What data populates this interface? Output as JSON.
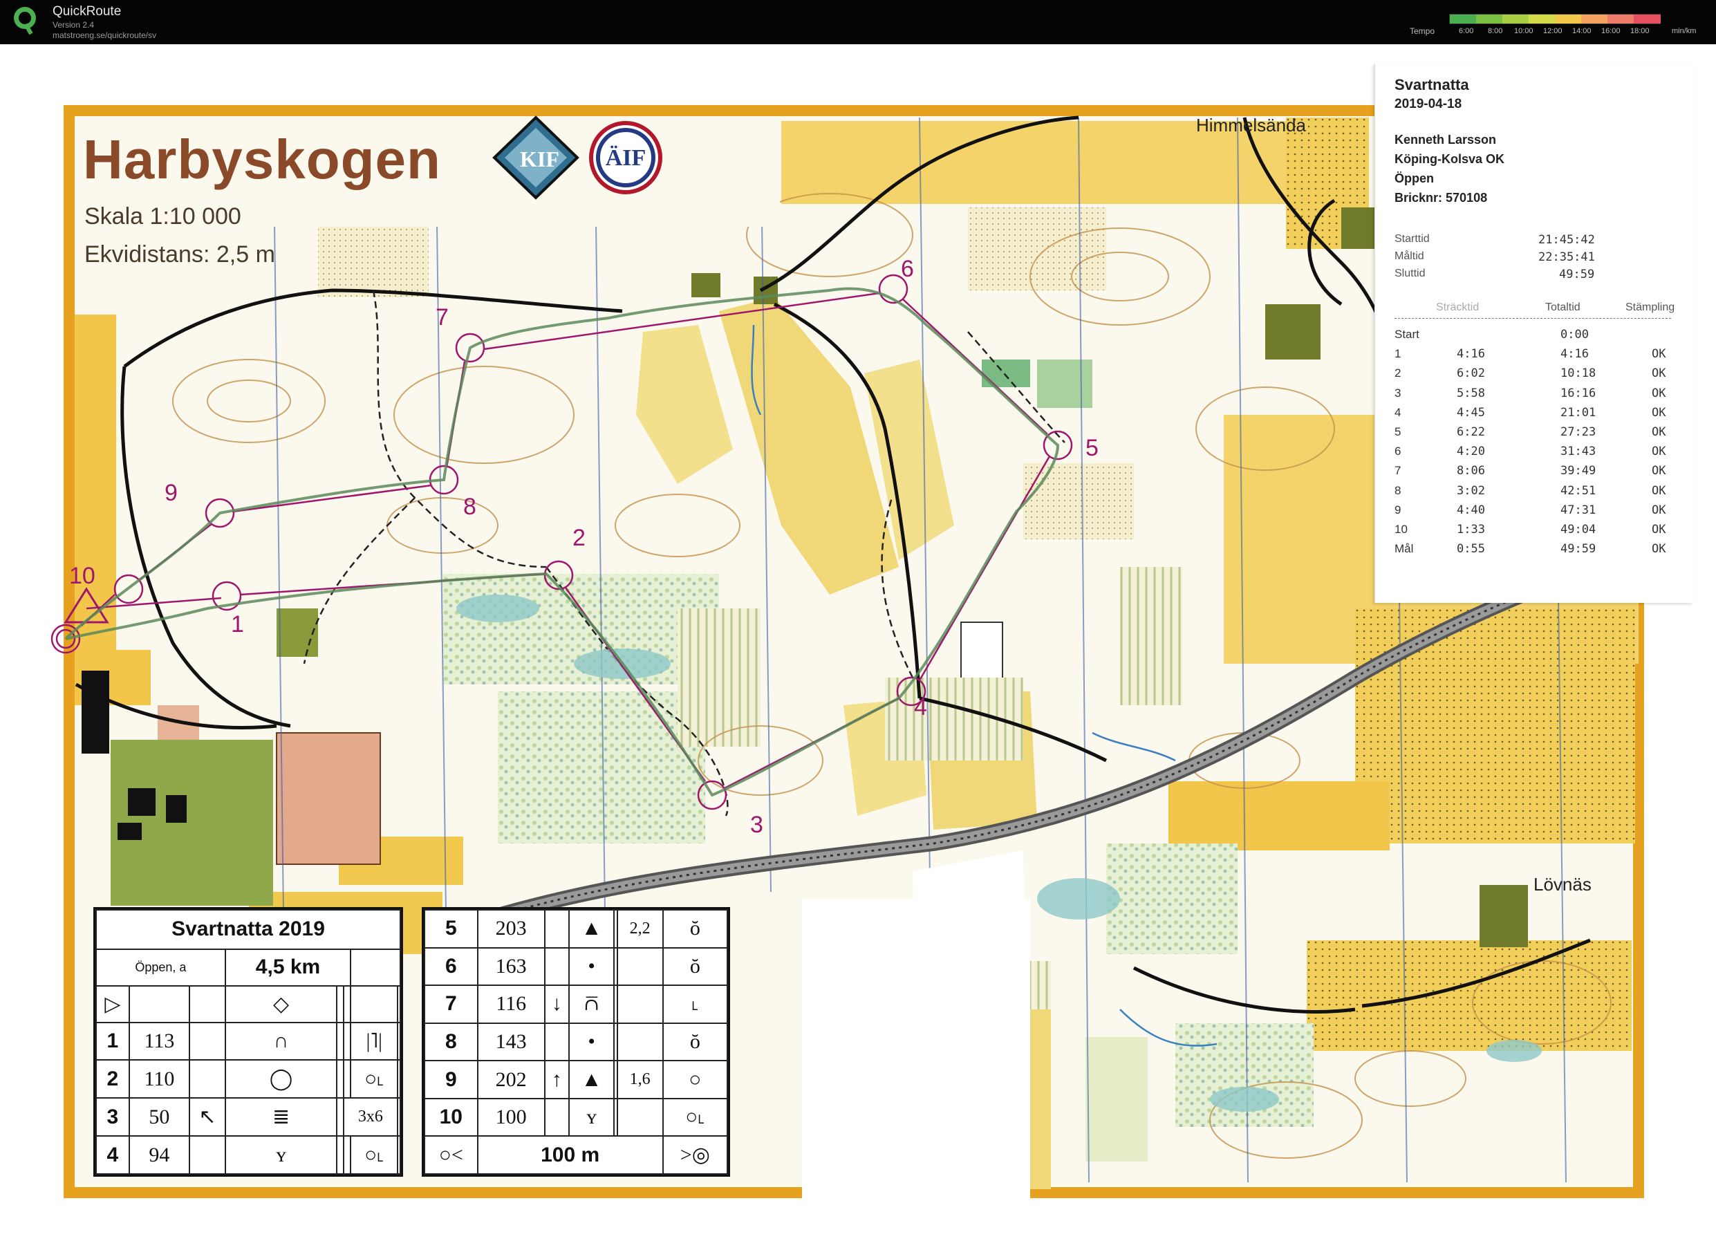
{
  "app": {
    "name": "QuickRoute",
    "version": "Version 2.4",
    "url": "matstroeng.se/quickroute/sv"
  },
  "tempo": {
    "label": "Tempo",
    "ticks": [
      "6:00",
      "8:00",
      "10:00",
      "12:00",
      "14:00",
      "16:00",
      "18:00"
    ],
    "unit": "min/km",
    "colors": [
      "#4caf50",
      "#7bc043",
      "#a8cf45",
      "#d4dc4a",
      "#f2c94c",
      "#f4a460",
      "#ef7b6b",
      "#e6505f"
    ]
  },
  "map": {
    "title": "Harbyskogen",
    "scale": "Skala 1:10 000",
    "ekvidistans": "Ekvidistans: 2,5 m",
    "logo1": "KIF",
    "logo2": "ÄIF",
    "places": {
      "himmelsanda": "Himmelsända",
      "lovnas": "Lövnäs"
    },
    "controls": [
      "1",
      "2",
      "3",
      "4",
      "5",
      "6",
      "7",
      "8",
      "9",
      "10"
    ]
  },
  "description": {
    "event": "Svartnatta 2019",
    "class": "Öppen, a",
    "length": "4,5 km",
    "left_rows": [
      {
        "n": "1",
        "code": "113",
        "d": "∩",
        "e": "",
        "f": "",
        "g": "|˥|"
      },
      {
        "n": "2",
        "code": "110",
        "d": "◯",
        "e": "",
        "f": "",
        "g": "○˪"
      },
      {
        "n": "3",
        "code": "50",
        "d": "≣",
        "c": "↖",
        "e": "",
        "f": "3x6",
        "g": ""
      },
      {
        "n": "4",
        "code": "94",
        "d": "ʏ",
        "e": "",
        "f": "",
        "g": "○˪"
      }
    ],
    "right_rows": [
      {
        "n": "5",
        "code": "203",
        "c": "",
        "d": "▲",
        "e": "",
        "f": "2,2",
        "g": "ŏ"
      },
      {
        "n": "6",
        "code": "163",
        "c": "",
        "d": "•",
        "e": "",
        "f": "",
        "g": "ŏ"
      },
      {
        "n": "7",
        "code": "116",
        "c": "↓",
        "d": "⩃",
        "e": "",
        "f": "",
        "g": "˪"
      },
      {
        "n": "8",
        "code": "143",
        "c": "",
        "d": "•",
        "e": "",
        "f": "",
        "g": "ŏ"
      },
      {
        "n": "9",
        "code": "202",
        "c": "↑",
        "d": "▲",
        "e": "",
        "f": "1,6",
        "g": "○"
      },
      {
        "n": "10",
        "code": "100",
        "c": "",
        "d": "ʏ",
        "e": "",
        "f": "",
        "g": "○˪"
      }
    ],
    "finish_distance": "100 m"
  },
  "slip": {
    "event": "Svartnatta",
    "date": "2019-04-18",
    "name": "Kenneth Larsson",
    "club": "Köping-Kolsva OK",
    "class": "Öppen",
    "bricknr": "Bricknr: 570108",
    "starttid_label": "Starttid",
    "starttid": "21:45:42",
    "maltid_label": "Måltid",
    "maltid": "22:35:41",
    "sluttid_label": "Sluttid",
    "sluttid": "49:59",
    "col_stracktid": "Sträcktid",
    "col_totaltid": "Totaltid",
    "col_stampling": "Stämpling",
    "rows": [
      {
        "ctrl": "Start",
        "leg": "",
        "total": "0:00",
        "status": ""
      },
      {
        "ctrl": "1",
        "leg": "4:16",
        "total": "4:16",
        "status": "OK"
      },
      {
        "ctrl": "2",
        "leg": "6:02",
        "total": "10:18",
        "status": "OK"
      },
      {
        "ctrl": "3",
        "leg": "5:58",
        "total": "16:16",
        "status": "OK"
      },
      {
        "ctrl": "4",
        "leg": "4:45",
        "total": "21:01",
        "status": "OK"
      },
      {
        "ctrl": "5",
        "leg": "6:22",
        "total": "27:23",
        "status": "OK"
      },
      {
        "ctrl": "6",
        "leg": "4:20",
        "total": "31:43",
        "status": "OK"
      },
      {
        "ctrl": "7",
        "leg": "8:06",
        "total": "39:49",
        "status": "OK"
      },
      {
        "ctrl": "8",
        "leg": "3:02",
        "total": "42:51",
        "status": "OK"
      },
      {
        "ctrl": "9",
        "leg": "4:40",
        "total": "47:31",
        "status": "OK"
      },
      {
        "ctrl": "10",
        "leg": "1:33",
        "total": "49:04",
        "status": "OK"
      },
      {
        "ctrl": "Mål",
        "leg": "0:55",
        "total": "49:59",
        "status": "OK"
      }
    ]
  }
}
